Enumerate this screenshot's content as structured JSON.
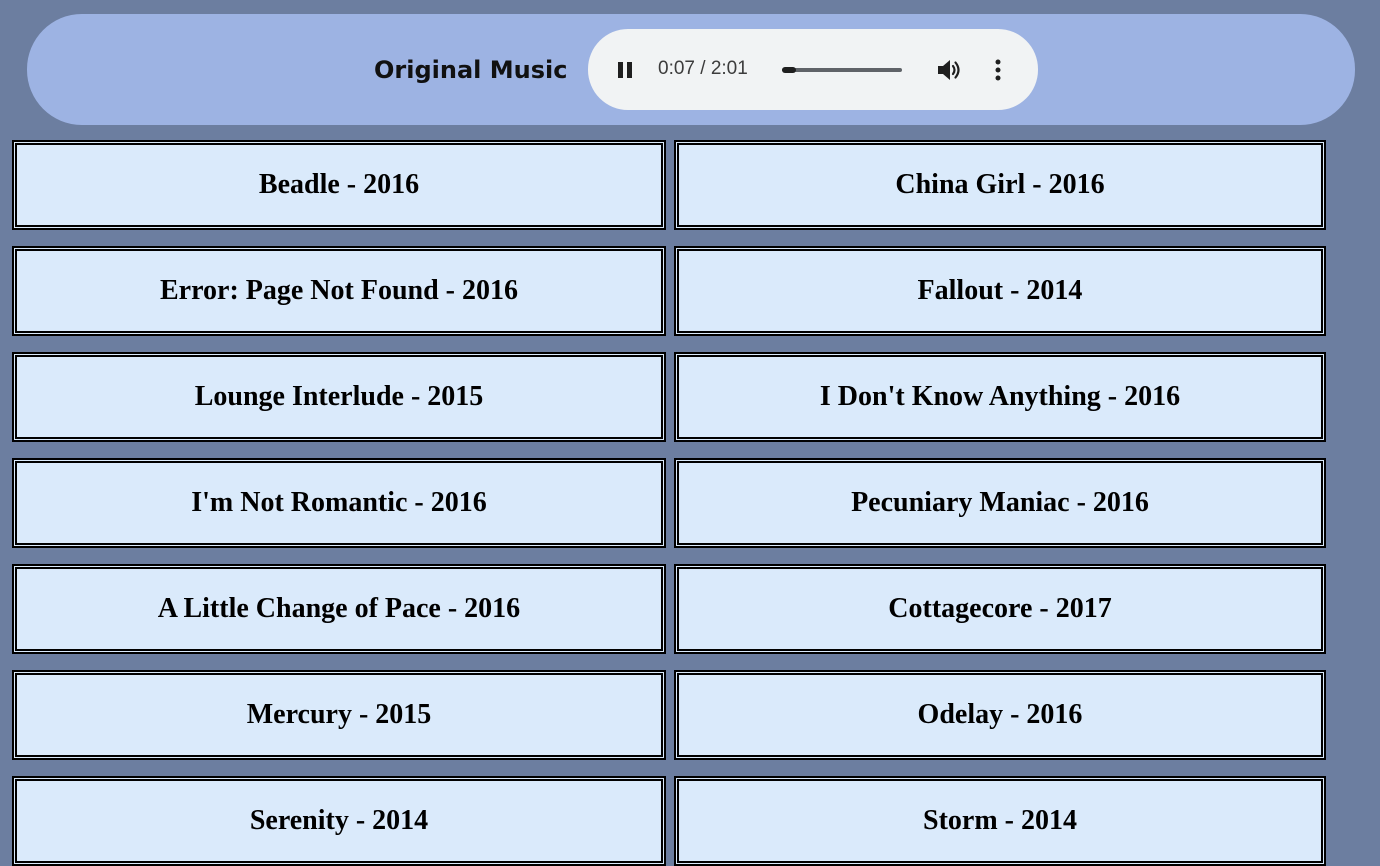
{
  "header": {
    "title": "Original Music"
  },
  "player": {
    "state": "playing",
    "time": "0:07 / 2:01",
    "progress_fraction": 0.058,
    "pause_icon": "pause-icon",
    "volume_icon": "volume-icon",
    "more_icon": "more-vert-icon"
  },
  "songs": [
    {
      "label": "Beadle - 2016"
    },
    {
      "label": "China Girl - 2016"
    },
    {
      "label": "Error: Page Not Found - 2016"
    },
    {
      "label": "Fallout - 2014"
    },
    {
      "label": "Lounge Interlude - 2015"
    },
    {
      "label": "I Don't Know Anything - 2016"
    },
    {
      "label": "I'm Not Romantic - 2016"
    },
    {
      "label": "Pecuniary Maniac - 2016"
    },
    {
      "label": "A Little Change of Pace - 2016"
    },
    {
      "label": "Cottagecore - 2017"
    },
    {
      "label": "Mercury - 2015"
    },
    {
      "label": "Odelay - 2016"
    },
    {
      "label": "Serenity - 2014"
    },
    {
      "label": "Storm - 2014"
    }
  ],
  "colors": {
    "page_background": "#6c7ea0",
    "header_background": "#9db3e3",
    "player_background": "#f1f3f4",
    "song_background": "#daeafb"
  }
}
